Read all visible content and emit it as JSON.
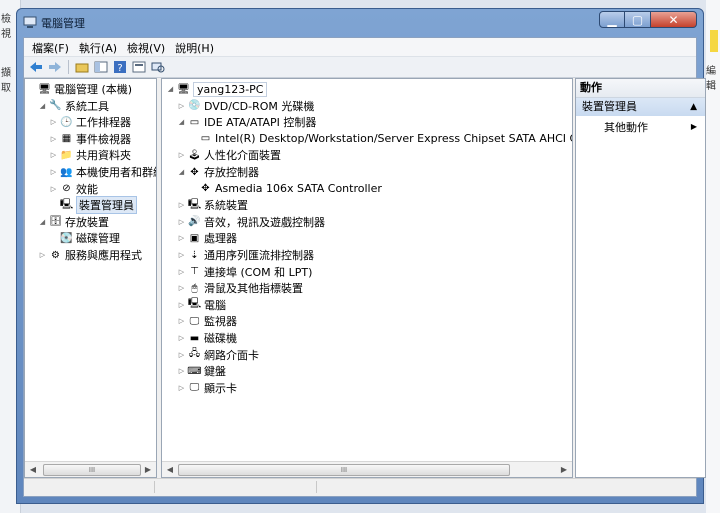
{
  "background": {
    "left_texts": [
      "檢視",
      "擷取"
    ],
    "right_text": "編輯"
  },
  "window": {
    "title": "電腦管理",
    "buttons": {
      "min": "▁",
      "max": "▢",
      "close": "✕"
    }
  },
  "menu": [
    "檔案(F)",
    "執行(A)",
    "檢視(V)",
    "說明(H)"
  ],
  "left_tree": [
    {
      "label": "電腦管理 (本機)",
      "indent": 0,
      "exp": "",
      "icon": "computer-management-icon",
      "glyph": "🖥"
    },
    {
      "label": "系統工具",
      "indent": 1,
      "exp": "◢",
      "icon": "system-tools-icon",
      "glyph": "🔧"
    },
    {
      "label": "工作排程器",
      "indent": 2,
      "exp": "▷",
      "icon": "task-scheduler-icon",
      "glyph": "🕒"
    },
    {
      "label": "事件檢視器",
      "indent": 2,
      "exp": "▷",
      "icon": "event-viewer-icon",
      "glyph": "▦"
    },
    {
      "label": "共用資料夾",
      "indent": 2,
      "exp": "▷",
      "icon": "shared-folders-icon",
      "glyph": "📁"
    },
    {
      "label": "本機使用者和群組",
      "indent": 2,
      "exp": "▷",
      "icon": "users-groups-icon",
      "glyph": "👥"
    },
    {
      "label": "效能",
      "indent": 2,
      "exp": "▷",
      "icon": "performance-icon",
      "glyph": "⊘"
    },
    {
      "label": "裝置管理員",
      "indent": 2,
      "exp": "",
      "icon": "device-manager-icon",
      "glyph": "🖳",
      "selected": true
    },
    {
      "label": "存放裝置",
      "indent": 1,
      "exp": "◢",
      "icon": "storage-icon",
      "glyph": "🗄"
    },
    {
      "label": "磁碟管理",
      "indent": 2,
      "exp": "",
      "icon": "disk-management-icon",
      "glyph": "💽"
    },
    {
      "label": "服務與應用程式",
      "indent": 1,
      "exp": "▷",
      "icon": "services-apps-icon",
      "glyph": "⚙"
    }
  ],
  "device_tree": [
    {
      "label": "yang123-PC",
      "indent": 0,
      "exp": "◢",
      "icon": "computer-icon",
      "glyph": "🖥",
      "root": true
    },
    {
      "label": "DVD/CD-ROM 光碟機",
      "indent": 1,
      "exp": "▷",
      "icon": "dvd-drive-icon",
      "glyph": "💿"
    },
    {
      "label": "IDE ATA/ATAPI 控制器",
      "indent": 1,
      "exp": "◢",
      "icon": "ide-controller-icon",
      "glyph": "▭"
    },
    {
      "label": "Intel(R) Desktop/Workstation/Server Express Chipset SATA AHCI C",
      "indent": 2,
      "exp": "",
      "icon": "sata-controller-icon",
      "glyph": "▭"
    },
    {
      "label": "人性化介面裝置",
      "indent": 1,
      "exp": "▷",
      "icon": "hid-icon",
      "glyph": "🕹"
    },
    {
      "label": "存放控制器",
      "indent": 1,
      "exp": "◢",
      "icon": "storage-controller-icon",
      "glyph": "✥"
    },
    {
      "label": "Asmedia 106x SATA Controller",
      "indent": 2,
      "exp": "",
      "icon": "asmedia-controller-icon",
      "glyph": "✥"
    },
    {
      "label": "系統裝置",
      "indent": 1,
      "exp": "▷",
      "icon": "system-devices-icon",
      "glyph": "🖳"
    },
    {
      "label": "音效，視訊及遊戲控制器",
      "indent": 1,
      "exp": "▷",
      "icon": "sound-icon",
      "glyph": "🔊"
    },
    {
      "label": "處理器",
      "indent": 1,
      "exp": "▷",
      "icon": "processor-icon",
      "glyph": "▣"
    },
    {
      "label": "通用序列匯流排控制器",
      "indent": 1,
      "exp": "▷",
      "icon": "usb-icon",
      "glyph": "⇣"
    },
    {
      "label": "連接埠 (COM 和 LPT)",
      "indent": 1,
      "exp": "▷",
      "icon": "ports-icon",
      "glyph": "⊤"
    },
    {
      "label": "滑鼠及其他指標裝置",
      "indent": 1,
      "exp": "▷",
      "icon": "mouse-icon",
      "glyph": "🖱"
    },
    {
      "label": "電腦",
      "indent": 1,
      "exp": "▷",
      "icon": "computer-node-icon",
      "glyph": "🖳"
    },
    {
      "label": "監視器",
      "indent": 1,
      "exp": "▷",
      "icon": "monitor-icon",
      "glyph": "🖵"
    },
    {
      "label": "磁碟機",
      "indent": 1,
      "exp": "▷",
      "icon": "disk-drive-icon",
      "glyph": "▬"
    },
    {
      "label": "網路介面卡",
      "indent": 1,
      "exp": "▷",
      "icon": "network-adapter-icon",
      "glyph": "🖧"
    },
    {
      "label": "鍵盤",
      "indent": 1,
      "exp": "▷",
      "icon": "keyboard-icon",
      "glyph": "⌨"
    },
    {
      "label": "顯示卡",
      "indent": 1,
      "exp": "▷",
      "icon": "display-adapter-icon",
      "glyph": "🖵"
    }
  ],
  "actions": {
    "header": "動作",
    "section": "裝置管理員",
    "item": "其他動作"
  },
  "scrollbar": {
    "thumb": "III"
  }
}
